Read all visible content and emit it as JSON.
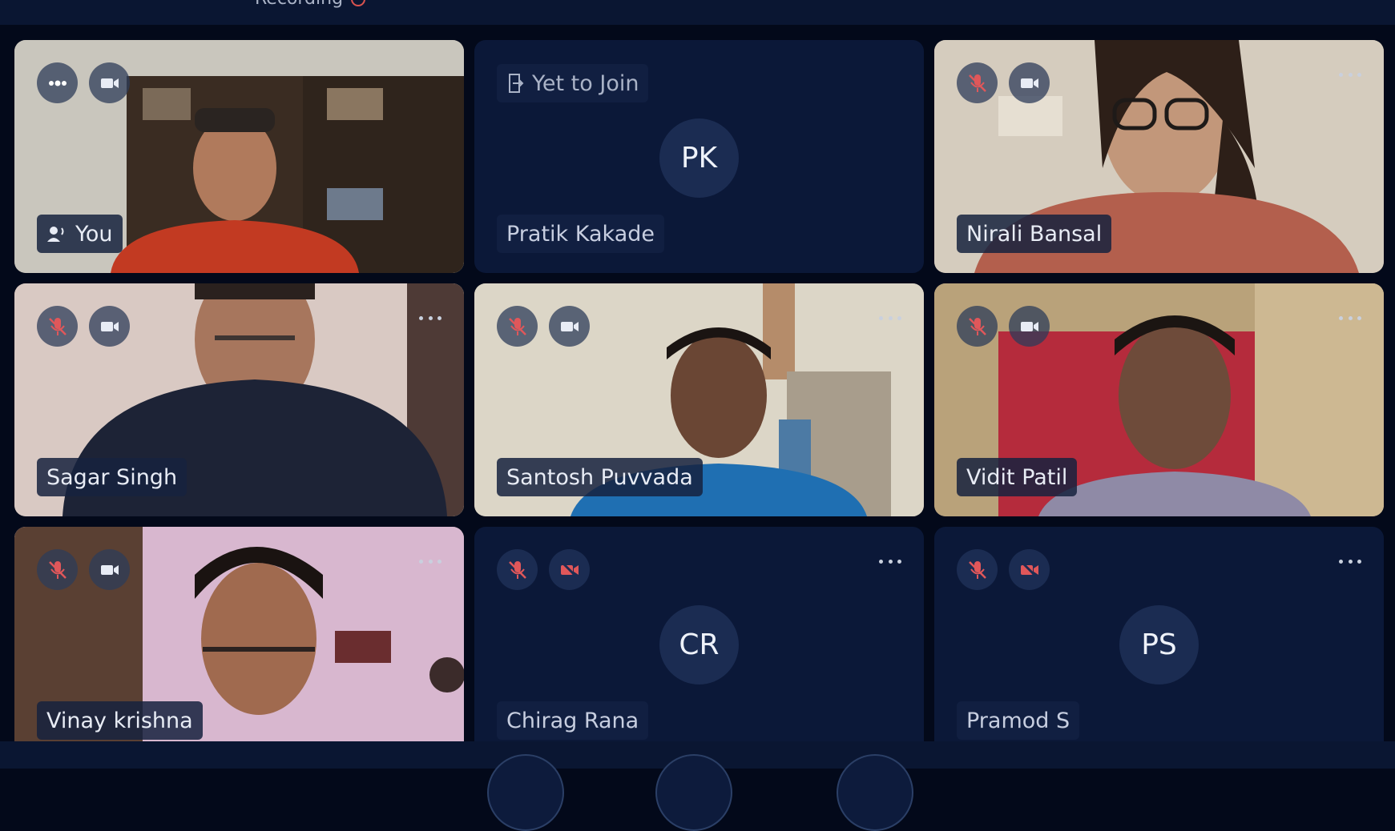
{
  "header": {
    "recording_label": "Recording"
  },
  "tiles": [
    {
      "name": "You",
      "kind": "video",
      "mic": "speaking",
      "camera": "on"
    },
    {
      "name": "Pratik Kakade",
      "kind": "waiting",
      "status": "Yet to Join",
      "initials": "PK"
    },
    {
      "name": "Nirali Bansal",
      "kind": "video",
      "mic": "muted",
      "camera": "on"
    },
    {
      "name": "Sagar Singh",
      "kind": "video",
      "mic": "muted",
      "camera": "on"
    },
    {
      "name": "Santosh Puvvada",
      "kind": "video",
      "mic": "muted",
      "camera": "on"
    },
    {
      "name": "Vidit Patil",
      "kind": "video",
      "mic": "muted",
      "camera": "on"
    },
    {
      "name": "Vinay krishna",
      "kind": "video",
      "mic": "muted",
      "camera": "on"
    },
    {
      "name": "Chirag Rana",
      "kind": "avatar",
      "initials": "CR",
      "mic": "muted",
      "camera": "off"
    },
    {
      "name": "Pramod S",
      "kind": "avatar",
      "initials": "PS",
      "mic": "muted",
      "camera": "off"
    }
  ],
  "colors": {
    "background": "#03091a",
    "tile": "#0b1838",
    "muted_icon": "#e0575a"
  },
  "icons": [
    "speaker-wave-icon",
    "mic-muted-icon",
    "camera-icon",
    "camera-off-icon",
    "more-icon",
    "exit-door-icon"
  ]
}
